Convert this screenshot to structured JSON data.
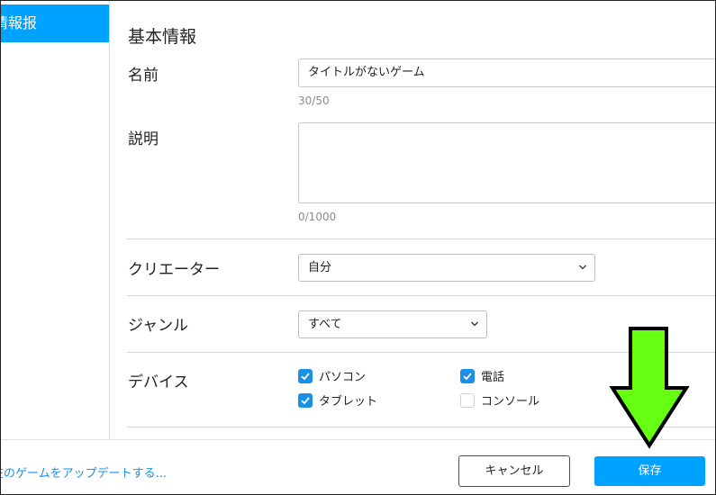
{
  "sidebar": {
    "items": [
      {
        "label": "情報报"
      }
    ]
  },
  "section": {
    "title": "基本情報"
  },
  "name": {
    "label": "名前",
    "value": "タイトルがないゲーム",
    "counter": "30/50"
  },
  "description": {
    "label": "説明",
    "value": "",
    "counter": "0/1000"
  },
  "creator": {
    "label": "クリエーター",
    "selected": "自分"
  },
  "genre": {
    "label": "ジャンル",
    "selected": "すべて"
  },
  "devices": {
    "label": "デバイス",
    "options": [
      {
        "label": "パソコン",
        "checked": true
      },
      {
        "label": "電話",
        "checked": true
      },
      {
        "label": "タブレット",
        "checked": true
      },
      {
        "label": "コンソール",
        "checked": false
      }
    ]
  },
  "footer": {
    "link": "在のゲームをアップデートする...",
    "cancel": "キャンセル",
    "save": "保存"
  },
  "colors": {
    "accent": "#00a2ff",
    "checkbox": "#1a90e6",
    "arrow_fill": "#66ff11",
    "arrow_stroke": "#000000"
  },
  "icons": {
    "chevron": "chevron-down-icon",
    "check": "check-icon",
    "pointer": "down-arrow-icon"
  }
}
